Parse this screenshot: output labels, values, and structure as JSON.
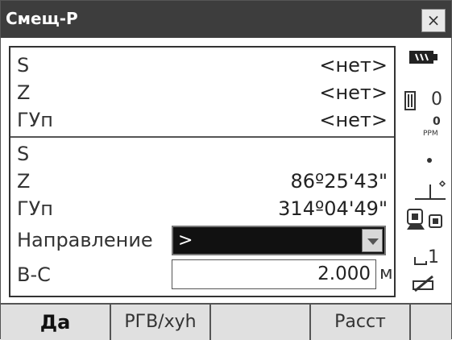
{
  "window": {
    "title": "Смещ-Р",
    "close_glyph": "×"
  },
  "rows": [
    {
      "label": "S",
      "value": "<нет>"
    },
    {
      "label": "Z",
      "value": "<нет>"
    },
    {
      "label": "ГУп",
      "value": "<нет>"
    },
    {
      "label": "S",
      "value": ""
    },
    {
      "label": "Z",
      "value": "86º25'43\""
    },
    {
      "label": "ГУп",
      "value": "314º04'49\""
    }
  ],
  "direction": {
    "label": "Направление",
    "value": ">"
  },
  "bc": {
    "label": "В-С",
    "value": "2.000",
    "unit": "м"
  },
  "side": {
    "prism_const": "0",
    "ppm_value": "0",
    "ppm_label": "PPM",
    "tilt_number": "1"
  },
  "softkeys": [
    "Да",
    "РГВ/xyh",
    "",
    "Расст",
    ""
  ],
  "icons": [
    "battery-icon",
    "prism-icon",
    "ppm-icon",
    "dot-icon",
    "tilt-icon",
    "instrument-icon",
    "laser-pointer-icon",
    "pen-icon"
  ]
}
